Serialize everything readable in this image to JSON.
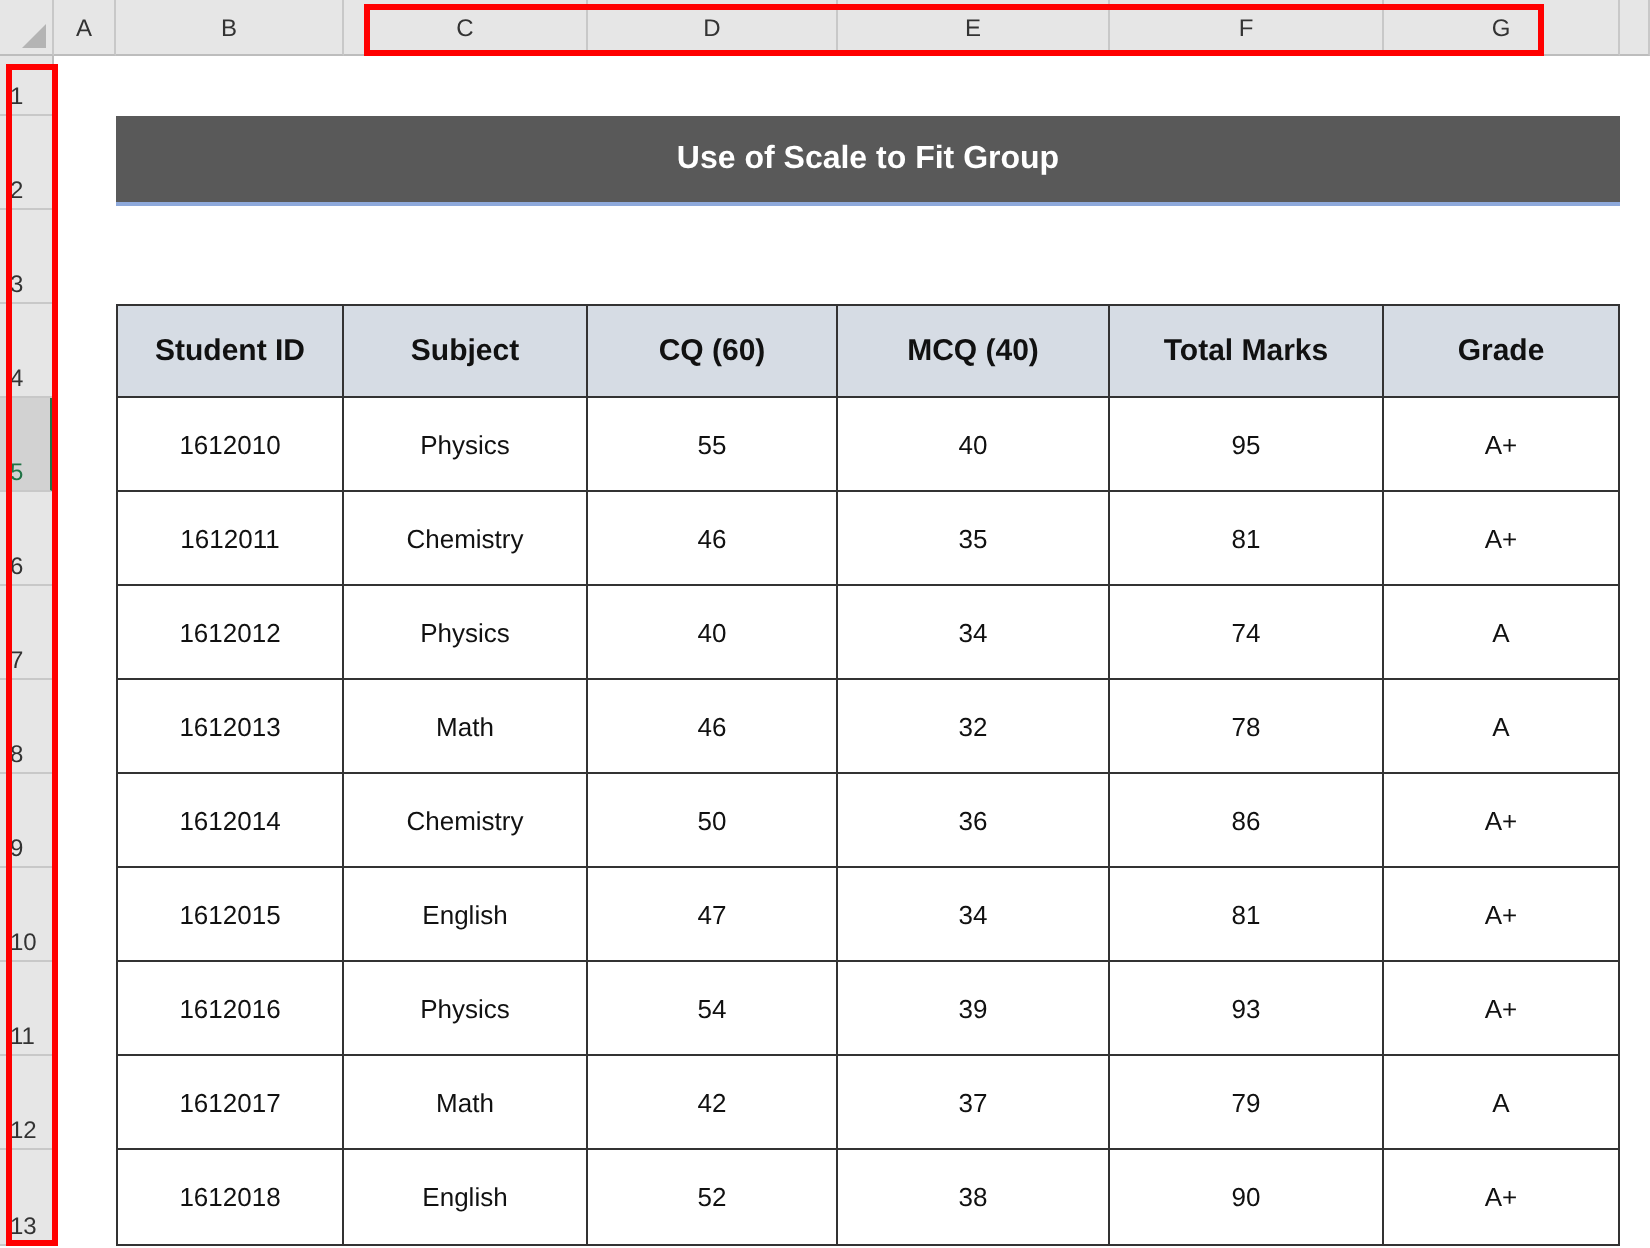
{
  "column_headers": [
    "A",
    "B",
    "C",
    "D",
    "E",
    "F",
    "G"
  ],
  "row_headers": [
    {
      "label": "1",
      "selected": false
    },
    {
      "label": "2",
      "selected": false
    },
    {
      "label": "3",
      "selected": false
    },
    {
      "label": "4",
      "selected": false
    },
    {
      "label": "5",
      "selected": true
    },
    {
      "label": "6",
      "selected": false
    },
    {
      "label": "7",
      "selected": false
    },
    {
      "label": "8",
      "selected": false
    },
    {
      "label": "9",
      "selected": false
    },
    {
      "label": "10",
      "selected": false
    },
    {
      "label": "11",
      "selected": false
    },
    {
      "label": "12",
      "selected": false
    },
    {
      "label": "13",
      "selected": false
    }
  ],
  "title": "Use of Scale to Fit Group",
  "table": {
    "columns": [
      "Student ID",
      "Subject",
      "CQ  (60)",
      "MCQ  (40)",
      "Total Marks",
      "Grade"
    ],
    "rows": [
      [
        "1612010",
        "Physics",
        "55",
        "40",
        "95",
        "A+"
      ],
      [
        "1612011",
        "Chemistry",
        "46",
        "35",
        "81",
        "A+"
      ],
      [
        "1612012",
        "Physics",
        "40",
        "34",
        "74",
        "A"
      ],
      [
        "1612013",
        "Math",
        "46",
        "32",
        "78",
        "A"
      ],
      [
        "1612014",
        "Chemistry",
        "50",
        "36",
        "86",
        "A+"
      ],
      [
        "1612015",
        "English",
        "47",
        "34",
        "81",
        "A+"
      ],
      [
        "1612016",
        "Physics",
        "54",
        "39",
        "93",
        "A+"
      ],
      [
        "1612017",
        "Math",
        "42",
        "37",
        "79",
        "A"
      ],
      [
        "1612018",
        "English",
        "52",
        "38",
        "90",
        "A+"
      ]
    ]
  }
}
